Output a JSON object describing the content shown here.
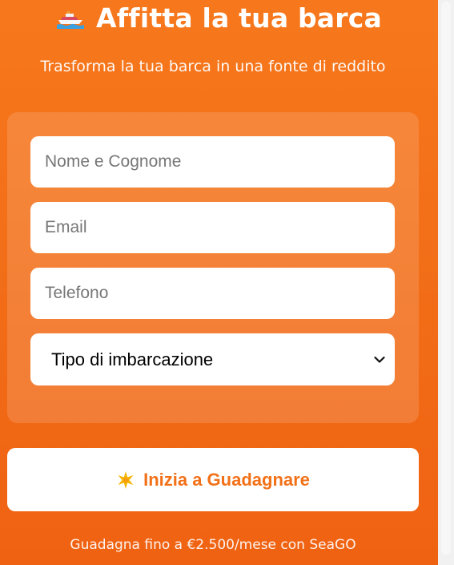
{
  "header": {
    "icon": "boat-icon",
    "title": "Affitta la tua barca",
    "subtitle": "Trasforma la tua barca in una fonte di reddito"
  },
  "form": {
    "name_placeholder": "Nome e Cognome",
    "email_placeholder": "Email",
    "phone_placeholder": "Telefono",
    "boat_type_select": {
      "selected": "Tipo di imbarcazione",
      "icon": "chevron-down-icon"
    }
  },
  "cta": {
    "icon": "sparkle-icon",
    "label": "Inizia a Guadagnare"
  },
  "footer": {
    "note": "Guadagna fino a €2.500/mese con SeaGO"
  },
  "colors": {
    "background_top": "#f7781c",
    "background_bottom": "#ef6212",
    "accent_text": "#f27118",
    "field_background": "#ffffff"
  }
}
